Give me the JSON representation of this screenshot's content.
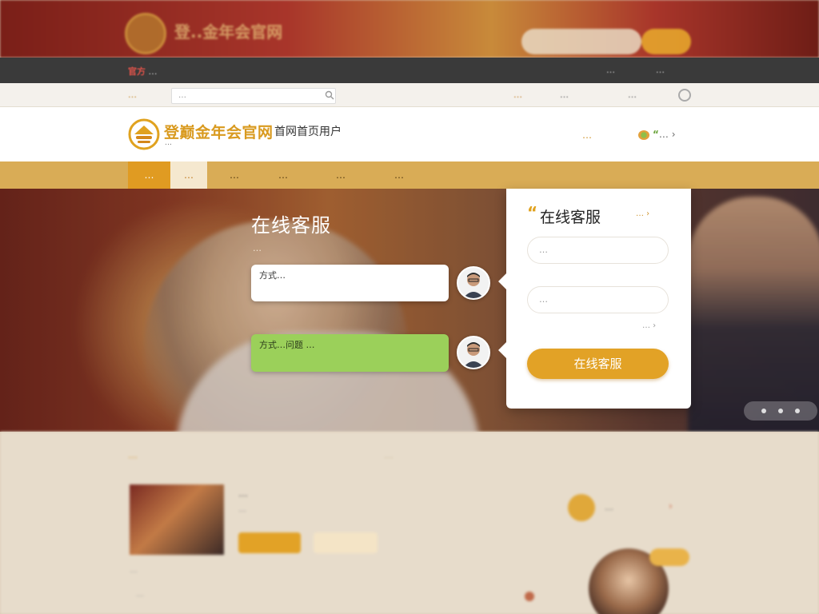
{
  "top_banner": {
    "logo_text": "登..金年会官网",
    "search_placeholder": "",
    "search_button": ""
  },
  "dark_bar": {
    "left_prefix": "官方",
    "left_text": "…",
    "right_1": "…",
    "right_2": "…"
  },
  "util_bar": {
    "home_label": "…",
    "search_placeholder": "…",
    "link_1": "…",
    "link_2": "…",
    "link_3": "…"
  },
  "header": {
    "brand": "登巅金年会官网",
    "brand_suffix": "首网首页用户",
    "subtitle": "…",
    "link_1": "…",
    "link_2": "…"
  },
  "nav": {
    "tabs": [
      {
        "label": "…"
      },
      {
        "label": "…"
      },
      {
        "label": "…"
      },
      {
        "label": "…"
      },
      {
        "label": "…"
      },
      {
        "label": "…"
      }
    ]
  },
  "hero": {
    "title": "在线客服",
    "subtitle": "…"
  },
  "chat": {
    "message_1": "方式…",
    "message_2": "方式…问题 …"
  },
  "panel": {
    "title": "在线客服",
    "link": "…",
    "input_1_placeholder": "…",
    "input_2_placeholder": "…",
    "more_link": "…",
    "cta": "在线客服"
  },
  "lower": {
    "section_title": "…",
    "section_mid": "…",
    "item_title": "…",
    "item_desc": "…",
    "caption": "…",
    "line": "…",
    "side_text": "…"
  },
  "colors": {
    "accent": "#e2a226",
    "nav_bg": "#d9ac56",
    "dark_bar": "#3a3a3a",
    "bubble_green": "#9bd05a"
  }
}
